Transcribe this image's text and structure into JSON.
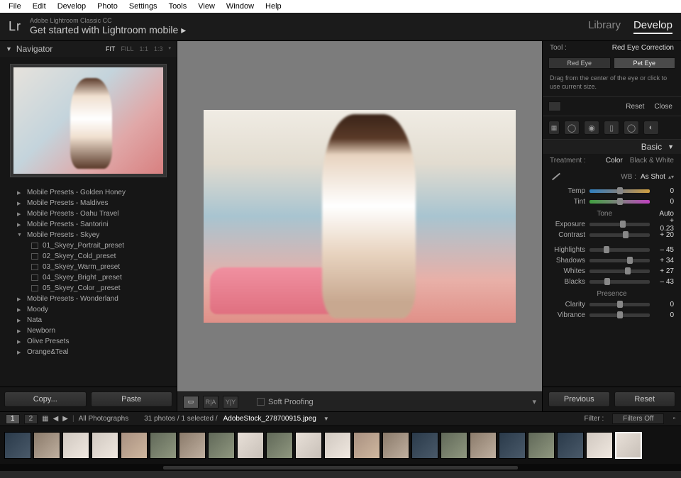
{
  "win_menu": [
    "File",
    "Edit",
    "Develop",
    "Photo",
    "Settings",
    "Tools",
    "View",
    "Window",
    "Help"
  ],
  "header": {
    "logo": "Lr",
    "product": "Adobe Lightroom Classic CC",
    "tagline": "Get started with Lightroom mobile  ▸",
    "modules": {
      "library": "Library",
      "develop": "Develop"
    }
  },
  "navigator": {
    "title": "Navigator",
    "modes": [
      "FIT",
      "FILL",
      "1:1",
      "1:3"
    ],
    "mode_sel": "FIT"
  },
  "presets": {
    "folders": [
      {
        "name": "Mobile Presets - Golden Honey",
        "open": false
      },
      {
        "name": "Mobile Presets - Maldives",
        "open": false
      },
      {
        "name": "Mobile Presets - Oahu Travel",
        "open": false
      },
      {
        "name": "Mobile Presets - Santorini",
        "open": false
      },
      {
        "name": "Mobile Presets - Skyey",
        "open": true,
        "items": [
          "01_Skyey_Portrait_preset",
          "02_Skyey_Cold_preset",
          "03_Skyey_Warm_preset",
          "04_Skyey_Bright _preset",
          "05_Skyey_Color _preset"
        ]
      },
      {
        "name": "Mobile Presets - Wonderland",
        "open": false
      },
      {
        "name": "Moody",
        "open": false
      },
      {
        "name": "Nata",
        "open": false
      },
      {
        "name": "Newborn",
        "open": false
      },
      {
        "name": "Olive Presets",
        "open": false
      },
      {
        "name": "Orange&Teal",
        "open": false
      }
    ]
  },
  "copy_paste": {
    "copy": "Copy...",
    "paste": "Paste"
  },
  "center_toolbar": {
    "soft_proofing": "Soft Proofing"
  },
  "right": {
    "tool_label": "Tool :",
    "tool_value": "Red Eye Correction",
    "tabs": {
      "red_eye": "Red Eye",
      "pet_eye": "Pet Eye"
    },
    "hint": "Drag from the center of the eye or click to use current size.",
    "reset": "Reset",
    "close": "Close",
    "basic": "Basic",
    "treatment": {
      "label": "Treatment :",
      "color": "Color",
      "bw": "Black & White"
    },
    "wb": {
      "label": "WB :",
      "value": "As Shot"
    },
    "temp_label": "Temp",
    "temp_val": "0",
    "tint_label": "Tint",
    "tint_val": "0",
    "tone_title": "Tone",
    "auto": "Auto",
    "sliders": [
      {
        "label": "Exposure",
        "val": "+ 0.23",
        "pos": 55
      },
      {
        "label": "Contrast",
        "val": "+ 20",
        "pos": 60
      },
      {
        "label": "Highlights",
        "val": "– 45",
        "pos": 28
      },
      {
        "label": "Shadows",
        "val": "+ 34",
        "pos": 67
      },
      {
        "label": "Whites",
        "val": "+ 27",
        "pos": 64
      },
      {
        "label": "Blacks",
        "val": "– 43",
        "pos": 29
      }
    ],
    "presence_title": "Presence",
    "presence": [
      {
        "label": "Clarity",
        "val": "0",
        "pos": 50
      },
      {
        "label": "Vibrance",
        "val": "0",
        "pos": 50
      }
    ],
    "previous": "Previous",
    "reset_btn": "Reset"
  },
  "strip": {
    "page1": "1",
    "page2": "2",
    "crumb": "All Photographs",
    "count": "31 photos / 1 selected /",
    "filename": "AdobeStock_278700915.jpeg",
    "filter_lbl": "Filter :",
    "filter_val": "Filters Off"
  }
}
